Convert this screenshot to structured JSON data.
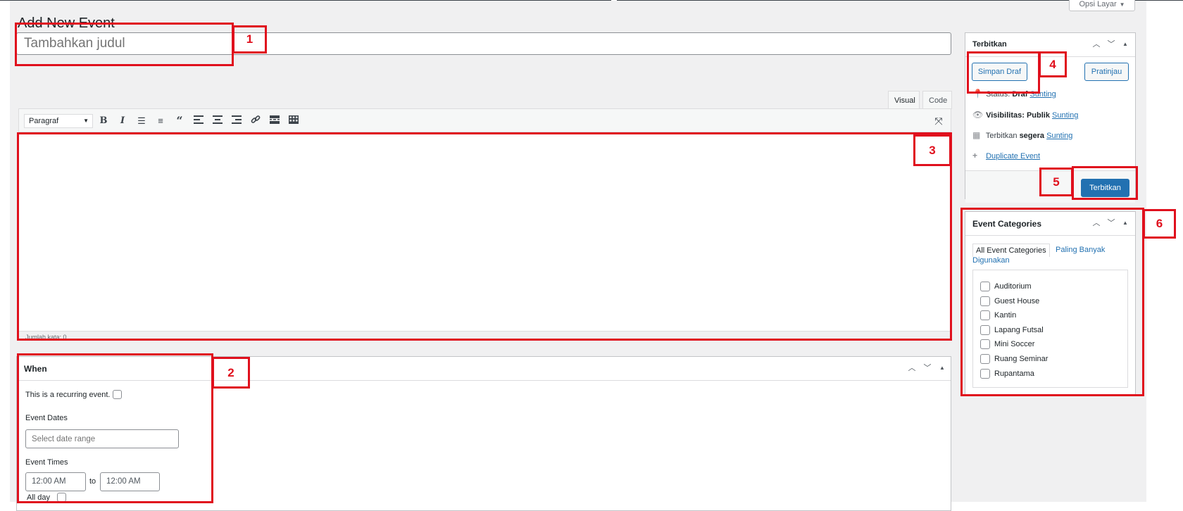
{
  "page": {
    "title": "Add New Event",
    "screen_options": "Opsi Layar"
  },
  "title_field": {
    "placeholder": "Tambahkan judul"
  },
  "editor": {
    "tabs": [
      "Visual",
      "Code"
    ],
    "format_value": "Paragraf",
    "toolbar_icons": [
      "bold-icon",
      "italic-icon",
      "bullet-list-icon",
      "numbered-list-icon",
      "blockquote-icon",
      "align-left-icon",
      "align-center-icon",
      "align-right-icon",
      "link-icon",
      "read-more-icon",
      "toolbar-toggle-icon",
      "fullscreen-icon"
    ],
    "word_count": "Jumlah kata: 0"
  },
  "when_box": {
    "title": "When",
    "recurring_label": "This is a recurring event.",
    "event_dates_label": "Event Dates",
    "date_placeholder": "Select date range",
    "event_times_label": "Event Times",
    "start_time": "12:00 AM",
    "to_label": "to",
    "end_time": "12:00 AM",
    "all_day_label": "All day"
  },
  "publish_box": {
    "title": "Terbitkan",
    "save_draft": "Simpan Draf",
    "preview": "Pratinjau",
    "status_label": "Status:",
    "status_value": "Draf",
    "visibility_label": "Visibilitas:",
    "visibility_value": "Publik",
    "schedule_label": "Terbitkan",
    "schedule_value": "segera",
    "edit_link": "Sunting",
    "duplicate_link": "Duplicate Event",
    "publish_button": "Terbitkan"
  },
  "categories_box": {
    "title": "Event Categories",
    "tab_all": "All Event Categories",
    "tab_popular": "Paling Banyak Digunakan",
    "items": [
      "Auditorium",
      "Guest House",
      "Kantin",
      "Lapang Futsal",
      "Mini Soccer",
      "Ruang Seminar",
      "Rupantama"
    ]
  },
  "annotations": [
    "1",
    "2",
    "3",
    "4",
    "5",
    "6"
  ],
  "colors": {
    "accent": "#2271b1",
    "annotation_red": "#e0101d",
    "page_background": "#f0f0f1"
  }
}
